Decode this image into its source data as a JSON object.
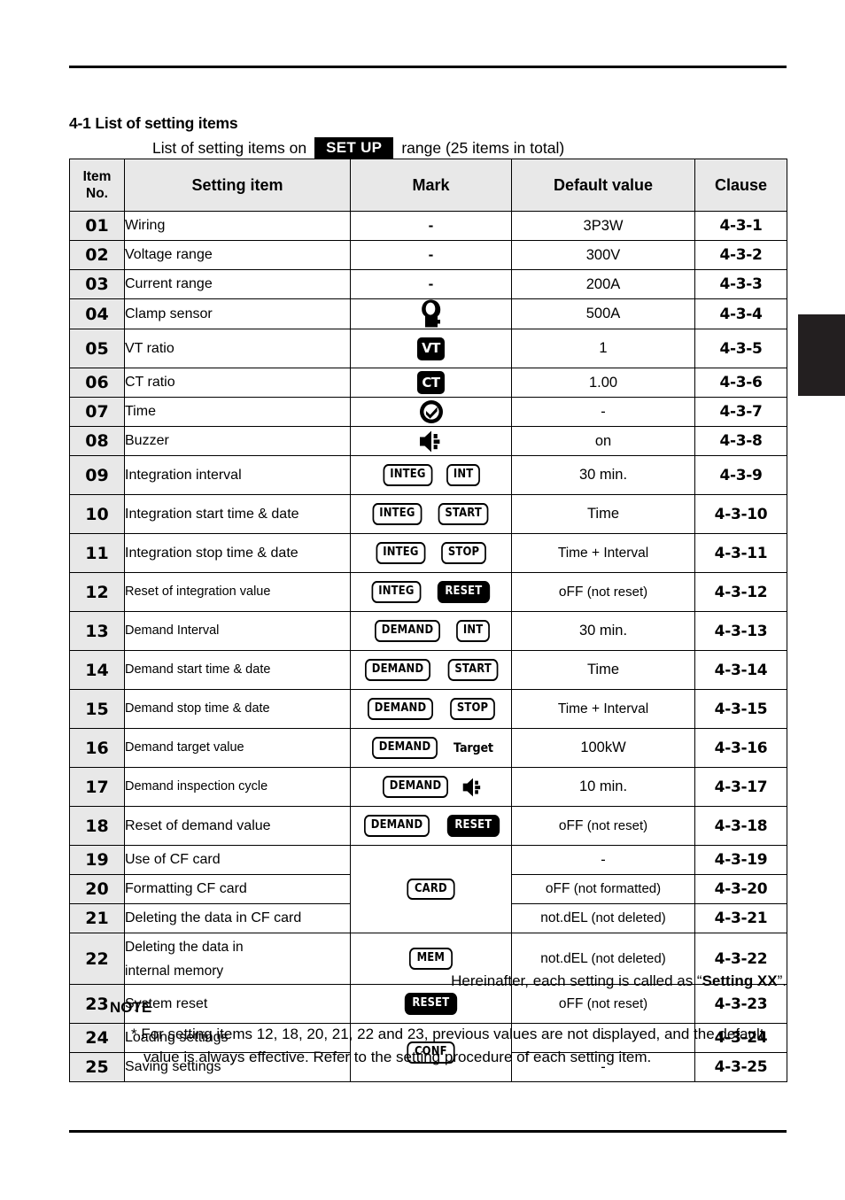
{
  "page": {
    "section_title": "4-1 List of setting items",
    "subtitle_before": "List of setting items on",
    "subtitle_badge": "SET UP",
    "subtitle_after": "range (25 items in total)",
    "hereinafter_prefix": "Hereinafter, each setting is called as “",
    "hereinafter_bold": "Setting XX",
    "hereinafter_suffix": "”.",
    "note_heading": "NOTE",
    "note_text": "* For setting items 12, 18, 20, 21, 22 and 23, previous values are not displayed, and the default value is always effective. Refer to the setting procedure of each setting item."
  },
  "table": {
    "headers": {
      "item_no_line1": "Item",
      "item_no_line2": "No.",
      "setting_item": "Setting item",
      "mark": "Mark",
      "default_value": "Default value",
      "clause": "Clause"
    },
    "rows": [
      {
        "no": "01",
        "item": "Wiring",
        "mark": "-",
        "default": "3P3W",
        "clause": "4-3-1"
      },
      {
        "no": "02",
        "item": "Voltage range",
        "mark": "-",
        "default": "300V",
        "clause": "4-3-2"
      },
      {
        "no": "03",
        "item": "Current range",
        "mark": "-",
        "default": "200A",
        "clause": "4-3-3"
      },
      {
        "no": "04",
        "item": "Clamp sensor",
        "mark": "clamp-sensor-icon",
        "default": "500A",
        "clause": "4-3-4"
      },
      {
        "no": "05",
        "item": "VT ratio",
        "mark": "VT",
        "default": "1",
        "clause": "4-3-5"
      },
      {
        "no": "06",
        "item": "CT ratio",
        "mark": "CT",
        "default": "1.00",
        "clause": "4-3-6"
      },
      {
        "no": "07",
        "item": "Time",
        "mark": "clock-icon",
        "default": "-",
        "clause": "4-3-7"
      },
      {
        "no": "08",
        "item": "Buzzer",
        "mark": "buzzer-icon",
        "default": "on",
        "clause": "4-3-8"
      },
      {
        "no": "09",
        "item": "Integration interval",
        "mark": "INTEG + INT",
        "default": "30 min.",
        "clause": "4-3-9"
      },
      {
        "no": "10",
        "item": "Integration start time & date",
        "mark": "INTEG + START",
        "default": "Time",
        "clause": "4-3-10"
      },
      {
        "no": "11",
        "item": "Integration stop time & date",
        "mark": "INTEG + STOP",
        "default": "Time + Interval",
        "clause": "4-3-11"
      },
      {
        "no": "12",
        "item": "Reset of integration value",
        "mark": "INTEG + RESET",
        "default": "oFF (not reset)",
        "clause": "4-3-12"
      },
      {
        "no": "13",
        "item": "Demand Interval",
        "mark": "DEMAND + INT",
        "default": "30 min.",
        "clause": "4-3-13"
      },
      {
        "no": "14",
        "item": "Demand start time & date",
        "mark": "DEMAND + START",
        "default": "Time",
        "clause": "4-3-14"
      },
      {
        "no": "15",
        "item": "Demand stop time & date",
        "mark": "DEMAND + STOP",
        "default": "Time + Interval",
        "clause": "4-3-15"
      },
      {
        "no": "16",
        "item": "Demand target value",
        "mark": "DEMAND + Target",
        "default": "100kW",
        "clause": "4-3-16"
      },
      {
        "no": "17",
        "item": "Demand inspection cycle",
        "mark": "DEMAND + buzzer-icon",
        "default": "10 min.",
        "clause": "4-3-17"
      },
      {
        "no": "18",
        "item": "Reset of demand value",
        "mark": "DEMAND + RESET",
        "default": "oFF (not reset)",
        "clause": "4-3-18"
      },
      {
        "no": "19",
        "item": "Use of CF card",
        "mark": "CARD",
        "default": "-",
        "clause": "4-3-19"
      },
      {
        "no": "20",
        "item": "Formatting CF card",
        "mark": "CARD",
        "default": "oFF (not formatted)",
        "clause": "4-3-20"
      },
      {
        "no": "21",
        "item": "Deleting the data in CF card",
        "mark": "CARD",
        "default": "not.dEL (not deleted)",
        "clause": "4-3-21"
      },
      {
        "no": "22",
        "item": "Deleting the data in\ninternal memory",
        "item_line1": "Deleting the data in",
        "item_line2": "internal memory",
        "mark": "MEM",
        "default": "not.dEL (not deleted)",
        "clause": "4-3-22"
      },
      {
        "no": "23",
        "item": "System reset",
        "mark": "RESET",
        "default": "oFF (not reset)",
        "clause": "4-3-23"
      },
      {
        "no": "24",
        "item": "Loading settings",
        "mark": "CONF",
        "default": "-",
        "clause": "4-3-24"
      },
      {
        "no": "25",
        "item": "Saving settings",
        "mark": "CONF",
        "default": "-",
        "clause": "4-3-25"
      }
    ],
    "mark_labels": {
      "integ": "INTEG",
      "int": "INT",
      "start": "START",
      "stop": "STOP",
      "reset": "RESET",
      "demand": "DEMAND",
      "target": "Target",
      "card": "CARD",
      "mem": "MEM",
      "conf": "CONF",
      "vt": "VT",
      "ct": "CT",
      "dash": "-"
    },
    "default_values_split": {
      "r12_main": "oFF",
      "r12_paren": "(not reset)",
      "r18_main": "oFF",
      "r18_paren": "(not reset)",
      "r20_main": "oFF",
      "r20_paren": "(not formatted)",
      "r21_main": "not.dEL",
      "r21_paren": "(not deleted)",
      "r22_main": "not.dEL",
      "r22_paren": "(not deleted)",
      "r23_main": "oFF",
      "r23_paren": "(not reset)"
    }
  },
  "colors": {
    "ink": "#000000",
    "header_fill": "#e8e8e8",
    "tab_fill": "#231f20",
    "page": "#ffffff"
  }
}
